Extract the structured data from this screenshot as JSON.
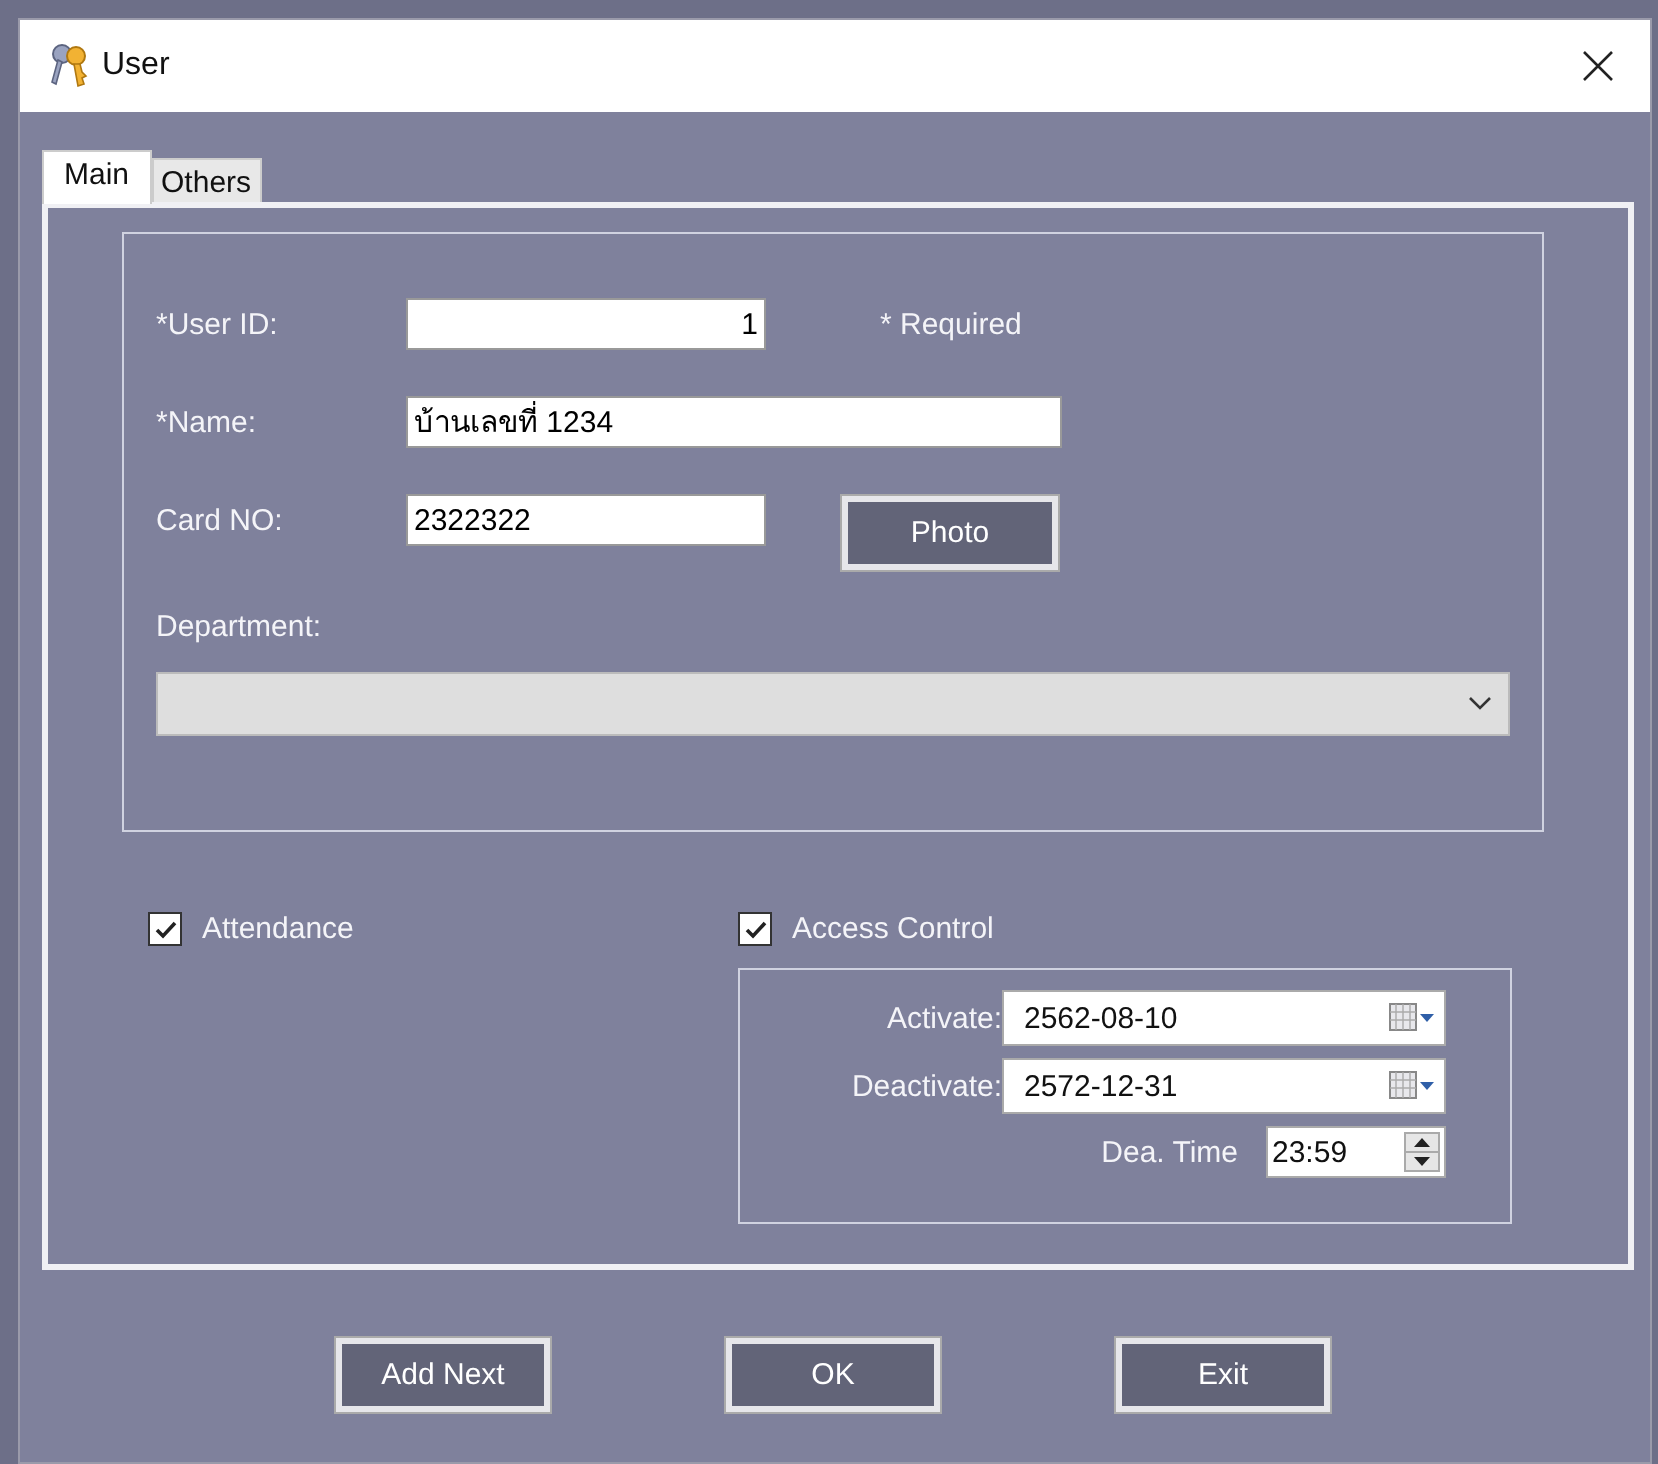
{
  "window": {
    "title": "User"
  },
  "tabs": [
    {
      "label": "Main",
      "selected": true
    },
    {
      "label": "Others",
      "selected": false
    }
  ],
  "user_id": {
    "label": "*User ID:",
    "value": "1",
    "note": "* Required"
  },
  "name": {
    "label": "*Name:",
    "value": "บ้านเลขที่ 1234"
  },
  "card_no": {
    "label": "Card NO:",
    "value": "2322322"
  },
  "photo_button": "Photo",
  "department": {
    "label": "Department:"
  },
  "attendance": {
    "label": "Attendance",
    "checked": true
  },
  "access_control": {
    "label": "Access Control",
    "checked": true
  },
  "activate": {
    "label": "Activate:",
    "value": "2562-08-10"
  },
  "deactivate": {
    "label": "Deactivate:",
    "value": "2572-12-31"
  },
  "dea_time": {
    "label": "Dea. Time",
    "value": "23:59"
  },
  "buttons": [
    "Add Next",
    "OK",
    "Exit"
  ]
}
